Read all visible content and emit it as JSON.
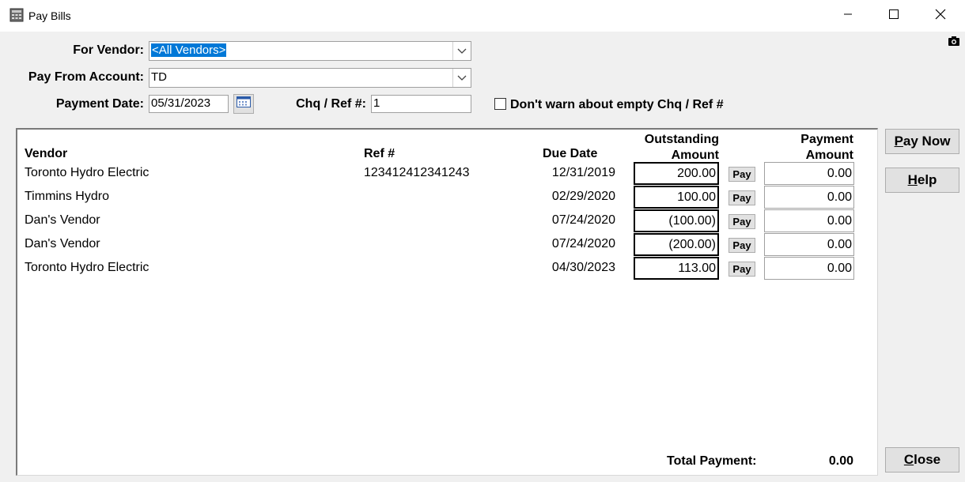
{
  "window": {
    "title": "Pay Bills",
    "app_icon": "calculator-icon"
  },
  "form": {
    "vendor_label": "For Vendor:",
    "vendor_value": "<All Vendors>",
    "account_label": "Pay From Account:",
    "account_value": "TD",
    "date_label": "Payment Date:",
    "date_value": "05/31/2023",
    "chq_label": "Chq / Ref #:",
    "chq_value": "1",
    "warn_checkbox_label": "Don't warn about empty Chq / Ref #",
    "warn_checked": false
  },
  "table": {
    "headers": {
      "vendor": "Vendor",
      "ref": "Ref #",
      "due_date": "Due Date",
      "outstanding_line1": "Outstanding",
      "outstanding_line2": "Amount",
      "payment_line1": "Payment",
      "payment_line2": "Amount"
    },
    "pay_label": "Pay",
    "rows": [
      {
        "vendor": "Toronto Hydro Electric",
        "ref": "123412412341243",
        "due": "12/31/2019",
        "outstanding": "200.00",
        "payment": "0.00"
      },
      {
        "vendor": "Timmins Hydro",
        "ref": "",
        "due": "02/29/2020",
        "outstanding": "100.00",
        "payment": "0.00"
      },
      {
        "vendor": "Dan's Vendor",
        "ref": "",
        "due": "07/24/2020",
        "outstanding": "(100.00)",
        "payment": "0.00"
      },
      {
        "vendor": "Dan's Vendor",
        "ref": "",
        "due": "07/24/2020",
        "outstanding": "(200.00)",
        "payment": "0.00"
      },
      {
        "vendor": "Toronto Hydro Electric",
        "ref": "",
        "due": "04/30/2023",
        "outstanding": "113.00",
        "payment": "0.00"
      }
    ],
    "total_label": "Total Payment:",
    "total_value": "0.00"
  },
  "buttons": {
    "pay_now": {
      "mnemonic": "P",
      "rest": "ay Now"
    },
    "help": {
      "mnemonic": "H",
      "rest": "elp"
    },
    "close": {
      "mnemonic": "C",
      "rest": "lose"
    }
  }
}
